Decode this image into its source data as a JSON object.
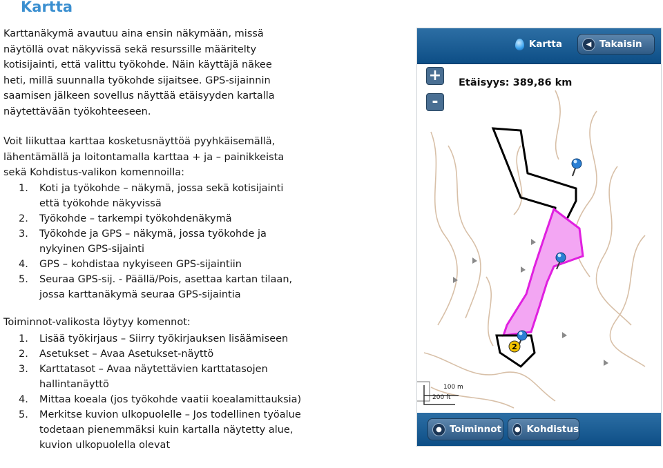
{
  "heading": "Kartta",
  "intro": "Karttanäkymä avautuu aina ensin näkymään, missä näytöllä ovat näkyvissä sekä resurssille määritelty kotisijainti, että valittu työkohde. Näin käyttäjä näkee heti, millä suunnalla työkohde sijaitsee. GPS-sijainnin saamisen jälkeen sovellus näyttää etäisyyden kartalla näytettävään työkohteeseen.",
  "navigation_intro": "Voit liikuttaa karttaa kosketusnäyttöä pyyhkäisemällä, lähentämällä ja loitontamalla karttaa + ja – painikkeista sekä Kohdistus-valikon komennoilla:",
  "aim_list": [
    {
      "num": "1.",
      "text": "Koti ja työkohde – näkymä, jossa sekä kotisijainti että työkohde näkyvissä"
    },
    {
      "num": "2.",
      "text": "Työkohde – tarkempi työkohdenäkymä"
    },
    {
      "num": "3.",
      "text": "Työkohde ja GPS – näkymä, jossa työkohde ja nykyinen GPS-sijainti"
    },
    {
      "num": "4.",
      "text": "GPS – kohdistaa nykyiseen GPS-sijaintiin"
    },
    {
      "num": "5.",
      "text": "Seuraa GPS-sij. - Päällä/Pois, asettaa kartan tilaan, jossa karttanäkymä seuraa GPS-sijaintia"
    }
  ],
  "functions_intro": "Toiminnot-valikosta löytyy komennot:",
  "functions_list": [
    {
      "num": "1.",
      "text": "Lisää työkirjaus – Siirry työkirjauksen lisäämiseen"
    },
    {
      "num": "2.",
      "text": "Asetukset – Avaa Asetukset-näyttö"
    },
    {
      "num": "3.",
      "text": "Karttatasot – Avaa näytettävien karttatasojen hallintanäyttö"
    },
    {
      "num": "4.",
      "text": "Mittaa koeala (jos työkohde vaatii koealamittauksia)"
    },
    {
      "num": "5.",
      "text": "Merkitse kuvion ulkopuolelle – Jos todellinen työalue todetaan pienemmäksi kuin kartalla näytetty alue, kuvion ulkopuolella olevat"
    }
  ],
  "map": {
    "title": "Kartta",
    "back_label": "Takaisin",
    "zoom_in": "+",
    "zoom_out": "-",
    "distance": "Etäisyys: 389,86 km",
    "scale_m": "100 m",
    "scale_ft": "200 ft",
    "marker_label": "2",
    "functions_label": "Toiminnot",
    "aim_label": "Kohdistus",
    "colors": {
      "bar": "#1d5f97",
      "work_area": "#f3a6f3",
      "work_area_stroke": "#e020e0",
      "contour": "#d8c0a8",
      "pin": "#2a7fd4"
    },
    "icons": [
      "kartta-drop-icon",
      "back-arrow-icon",
      "functions-icon",
      "aim-icon",
      "gps-pin-icon"
    ]
  }
}
